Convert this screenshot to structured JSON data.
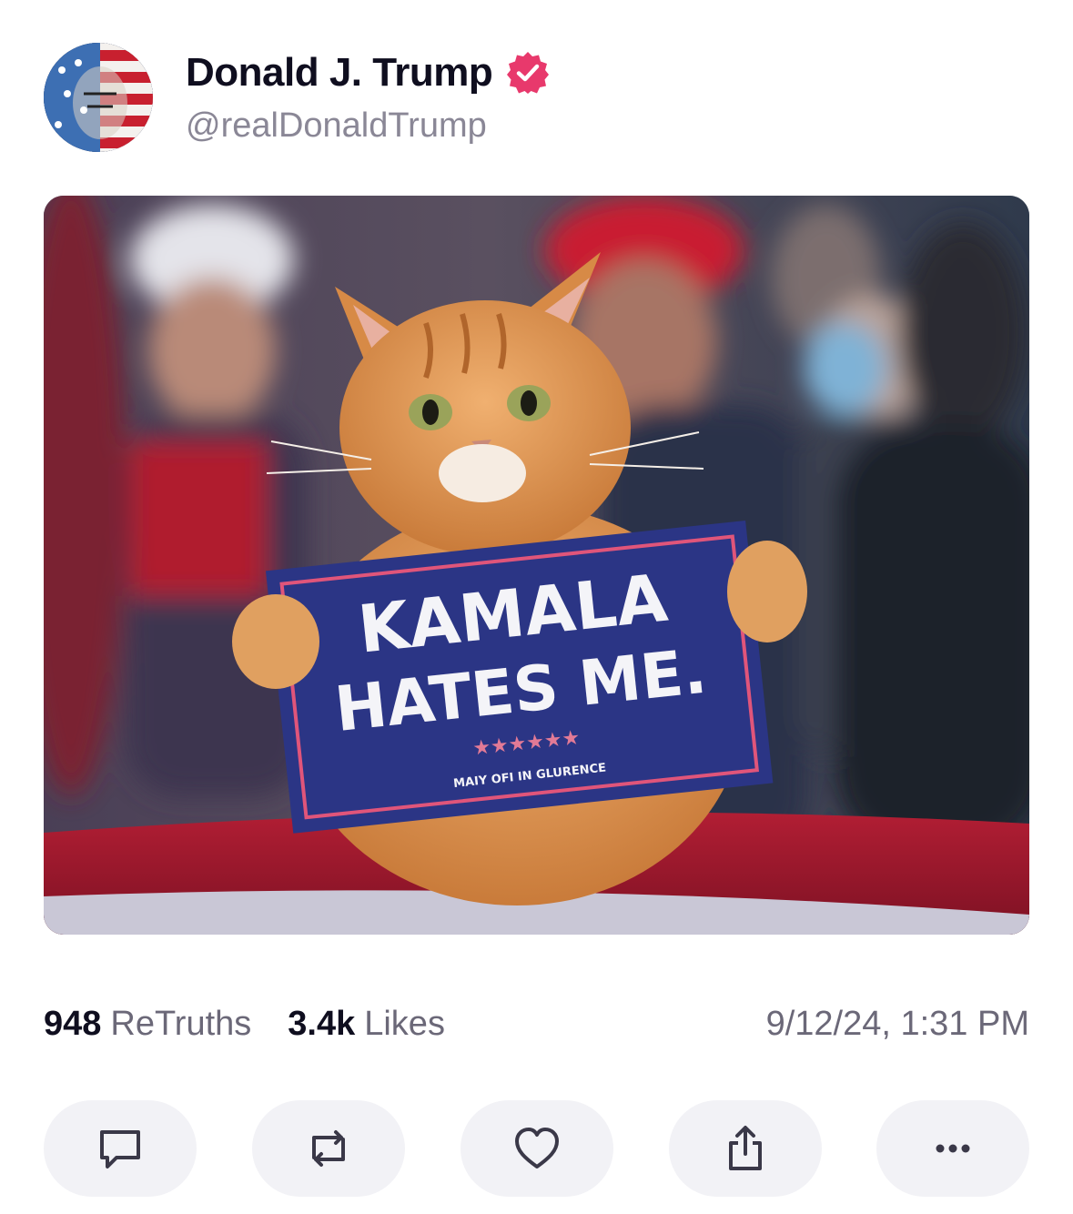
{
  "author": {
    "display_name": "Donald J. Trump",
    "handle": "@realDonaldTrump",
    "verified_icon": "verified-badge-icon",
    "verified_color": "#e8396c"
  },
  "media": {
    "sign": {
      "line1": "KAMALA",
      "line2": "HATES ME.",
      "small_text": "MAIY OFI IN GLURENCE"
    }
  },
  "stats": {
    "retruths_count": "948",
    "retruths_label": "ReTruths",
    "likes_count": "3.4k",
    "likes_label": "Likes",
    "timestamp": "9/12/24, 1:31 PM"
  },
  "actions": [
    {
      "name": "reply",
      "icon": "comment-icon"
    },
    {
      "name": "retruth",
      "icon": "repost-icon"
    },
    {
      "name": "like",
      "icon": "heart-icon"
    },
    {
      "name": "share",
      "icon": "share-icon"
    },
    {
      "name": "more",
      "icon": "more-icon"
    }
  ],
  "colors": {
    "text_primary": "#0f0e1f",
    "text_secondary": "#6b6878",
    "action_bg": "#f2f2f6",
    "icon_stroke": "#3a3848"
  }
}
